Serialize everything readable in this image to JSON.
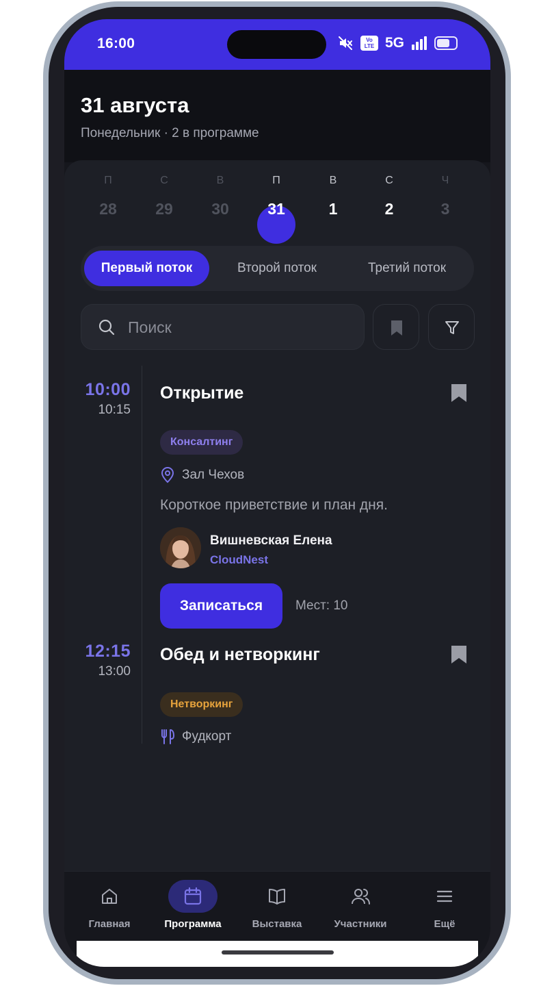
{
  "status_bar": {
    "time": "16:00",
    "network": "5G",
    "volte_top": "Vo",
    "volte_bottom": "LTE"
  },
  "header": {
    "title": "31 августа",
    "subtitle": "Понедельник · 2 в программе"
  },
  "week": [
    {
      "weekday": "П",
      "day": "28"
    },
    {
      "weekday": "С",
      "day": "29"
    },
    {
      "weekday": "В",
      "day": "30"
    },
    {
      "weekday": "П",
      "day": "31",
      "selected": true
    },
    {
      "weekday": "В",
      "day": "1"
    },
    {
      "weekday": "С",
      "day": "2"
    },
    {
      "weekday": "Ч",
      "day": "3"
    }
  ],
  "tabs": [
    {
      "label": "Первый поток",
      "active": true
    },
    {
      "label": "Второй поток"
    },
    {
      "label": "Третий поток"
    }
  ],
  "search": {
    "placeholder": "Поиск"
  },
  "events": [
    {
      "start": "10:00",
      "end": "10:15",
      "title": "Открытие",
      "tag": "Консалтинг",
      "place": "Зал Чехов",
      "description": "Короткое приветствие и план дня.",
      "speaker": {
        "name": "Вишневская Елена",
        "company": "CloudNest"
      },
      "action": "Записаться",
      "seats": "Мест: 10"
    },
    {
      "start": "12:15",
      "end": "13:00",
      "title": "Обед и нетворкинг",
      "tag": "Нетворкинг",
      "place": "Фудкорт"
    }
  ],
  "nav": [
    {
      "label": "Главная",
      "icon": "home-icon"
    },
    {
      "label": "Программа",
      "icon": "calendar-icon",
      "active": true
    },
    {
      "label": "Выставка",
      "icon": "book-icon"
    },
    {
      "label": "Участники",
      "icon": "people-icon"
    },
    {
      "label": "Ещё",
      "icon": "menu-icon"
    }
  ],
  "colors": {
    "accent": "#3f2ee0",
    "accent_text": "#7a74e8",
    "background": "#16171d",
    "tag_orange": "#e7a33c"
  }
}
